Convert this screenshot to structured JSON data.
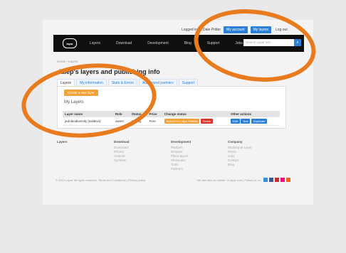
{
  "top": {
    "logged_in": "Logged in as Dale Pritter",
    "account": "My account",
    "layers": "My layers",
    "logout": "Log out"
  },
  "nav": {
    "logo": "layar",
    "items": [
      "Layers",
      "Download",
      "Development",
      "Blog",
      "Support",
      "Jobs"
    ],
    "search_placeholder": "Search Layar site..."
  },
  "crumb": "Home › Layers",
  "heading": "dalep's layers and publishing info",
  "tabs": [
    "Layers",
    "My information",
    "Stats & Errors",
    "Authorized partners",
    "Support"
  ],
  "panel": {
    "create": "Create a new layer",
    "my_layers": "My Layers"
  },
  "table": {
    "headers": [
      "Layer name",
      "Role",
      "Status",
      "Price",
      "Change status",
      "Other actions"
    ],
    "row": {
      "name": "jedi Biodiversity [soldev1]",
      "role": "owner",
      "status": "testing",
      "price": "Free",
      "submit": "Submit for Layar Publish",
      "delete": "Delete",
      "edit": "Edit",
      "test": "Test",
      "duplicate": "Duplicate"
    }
  },
  "footer": {
    "cols": [
      {
        "h": "Layers",
        "items": []
      },
      {
        "h": "Download",
        "items": [
          "Download",
          "iPhone",
          "Android",
          "Symbian"
        ]
      },
      {
        "h": "Development",
        "items": [
          "Platform",
          "Browser",
          "Place layers",
          "Showcase",
          "Tools",
          "Partners"
        ]
      },
      {
        "h": "Company",
        "items": [
          "Working at Layar",
          "Press",
          "Jobs",
          "Contact",
          "Blog"
        ]
      }
    ],
    "copyright": "© 2010 Layar. All rights reserved. Terms and Conditions | Privacy policy",
    "follow": "We are also on mobile: m.layar.com | Follow us on:"
  },
  "colors": {
    "accent": "#2b7fd6",
    "orange": "#f2a23a",
    "delete": "#d9342b",
    "annotation": "#e87b1e"
  }
}
